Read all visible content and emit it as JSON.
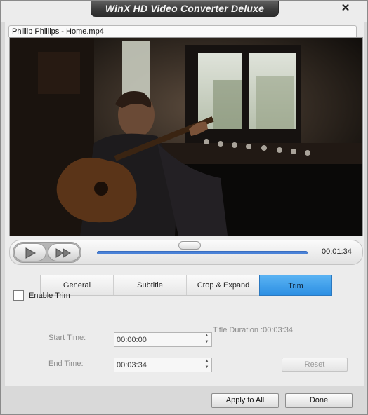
{
  "window": {
    "title": "WinX HD Video Converter Deluxe",
    "close_glyph": "✕"
  },
  "file": {
    "name": "Phillip Phillips - Home.mp4"
  },
  "player": {
    "play_icon": "play-icon",
    "fast_forward_icon": "fast-forward-icon",
    "duration_display": "00:01:34",
    "position_fraction": 0.44
  },
  "tabs": [
    {
      "label": "General",
      "active": false
    },
    {
      "label": "Subtitle",
      "active": false
    },
    {
      "label": "Crop & Expand",
      "active": false
    },
    {
      "label": "Trim",
      "active": true
    }
  ],
  "trim": {
    "enable_label": "Enable Trim",
    "enabled": false,
    "start_label": "Start Time:",
    "start_value": "00:00:00",
    "end_label": "End Time:",
    "end_value": "00:03:34",
    "title_duration": "Title Duration :00:03:34",
    "reset_label": "Reset"
  },
  "buttons": {
    "apply_all": "Apply to All",
    "done": "Done"
  },
  "colors": {
    "accent": "#2c8fe3",
    "track": "#4a82d8",
    "title_plate": "#3b3b3b"
  }
}
